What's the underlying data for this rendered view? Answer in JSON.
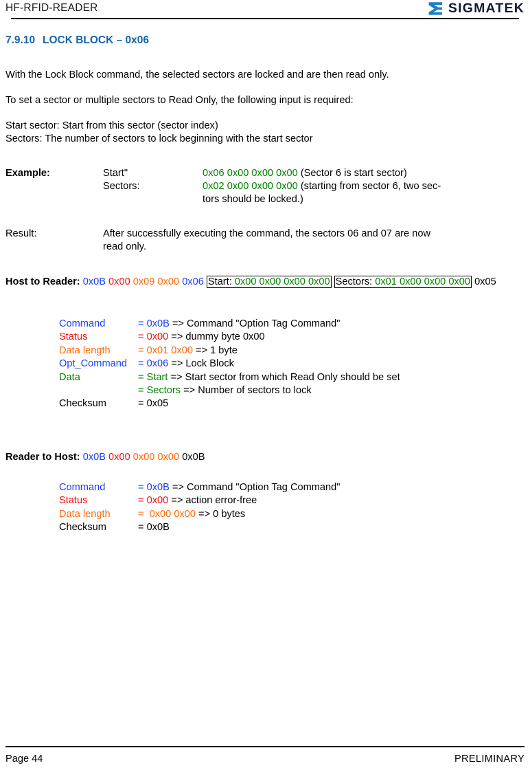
{
  "header": {
    "doc_title": "HF-RFID-READER",
    "logo_text": "SIGMATEK",
    "logo_icon": "sigmatek-sigma-mark",
    "brand_color": "#111a33",
    "mark_color": "#1b7fc4"
  },
  "section": {
    "number": "7.9.10",
    "title": "LOCK BLOCK – 0x06",
    "heading_color": "#1565a8"
  },
  "body": {
    "p1": "With the Lock Block command, the selected sectors are locked and are then read only.",
    "p2": "To set a sector or multiple sectors to Read Only, the following input is required:",
    "p3": "Start sector: Start from this sector (sector index)",
    "p4": "Sectors: The number of sectors to lock beginning with the start sector"
  },
  "example": {
    "label": "Example:",
    "rows": [
      {
        "name": "Start\"",
        "hex": "0x06 0x00 0x00 0x00",
        "note": "(Sector 6 is start sector)"
      },
      {
        "name": "Sectors:",
        "hex": "0x02 0x00 0x00 0x00",
        "note": "(starting from sector 6, two sec-",
        "note_cont": "tors should be locked.)"
      }
    ]
  },
  "result": {
    "label": "Result:",
    "text_line1": "After successfully executing the command, the sectors 06 and 07 are now",
    "text_line2": "read only."
  },
  "host_to_reader": {
    "label": "Host to Reader:",
    "command": "0x0B",
    "status": "0x00",
    "data_length": "0x09 0x00",
    "opt_command": "0x06",
    "start_label": "Start:",
    "start_value": "0x00 0x00 0x00 0x00",
    "sectors_label": "Sectors:",
    "sectors_value": "0x01 0x00 0x00 0x00",
    "checksum": "0x05",
    "fields": [
      {
        "name": "Command",
        "name_color": "blue",
        "eq": "=",
        "value": "0x0B",
        "value_color": "blue",
        "desc": " => Command \"Option Tag Command\""
      },
      {
        "name": "Status",
        "name_color": "red",
        "eq": "=",
        "value": "0x00",
        "value_color": "red",
        "desc": " => dummy byte 0x00"
      },
      {
        "name": "Data length",
        "name_color": "orange",
        "eq": "=",
        "value": "0x01 0x00",
        "value_color": "orange",
        "desc": " => 1 byte"
      },
      {
        "name": "Opt_Command",
        "name_color": "blue",
        "eq": "=",
        "value": "0x06",
        "value_color": "blue",
        "desc": " => Lock Block"
      },
      {
        "name": "Data",
        "name_color": "green",
        "eq": "=",
        "value": "Start",
        "value_color": "green",
        "desc": " => Start sector from which Read Only should be set"
      },
      {
        "name": "",
        "name_color": "green",
        "eq": "=",
        "value": "Sectors",
        "value_color": "green",
        "desc": " => Number of sectors to lock"
      },
      {
        "name": "Checksum",
        "name_color": "black",
        "eq": "=",
        "value": "0x05",
        "value_color": "black",
        "desc": ""
      }
    ]
  },
  "reader_to_host": {
    "label": "Reader to Host:",
    "command": "0x0B",
    "status": "0x00",
    "data_length": "0x00 0x00",
    "checksum": "0x0B",
    "fields": [
      {
        "name": "Command",
        "name_color": "blue",
        "eq": "=",
        "value": "0x0B",
        "value_color": "blue",
        "desc": " => Command \"Option Tag Command\""
      },
      {
        "name": "Status",
        "name_color": "red",
        "eq": "=",
        "value": "0x00",
        "value_color": "red",
        "desc": " => action error-free"
      },
      {
        "name": "Data length",
        "name_color": "orange",
        "eq": "=",
        "value": " 0x00 0x00",
        "value_color": "orange",
        "desc": " => 0 bytes"
      },
      {
        "name": "Checksum",
        "name_color": "black",
        "eq": "=",
        "value": "0x0B",
        "value_color": "black",
        "desc": ""
      }
    ]
  },
  "footer": {
    "page": "Page 44",
    "status": "PRELIMINARY"
  },
  "colors": {
    "blue": "#1b3df2",
    "red": "#f40f0f",
    "orange": "#ff6a0a",
    "green": "#008000",
    "black": "#000000"
  }
}
